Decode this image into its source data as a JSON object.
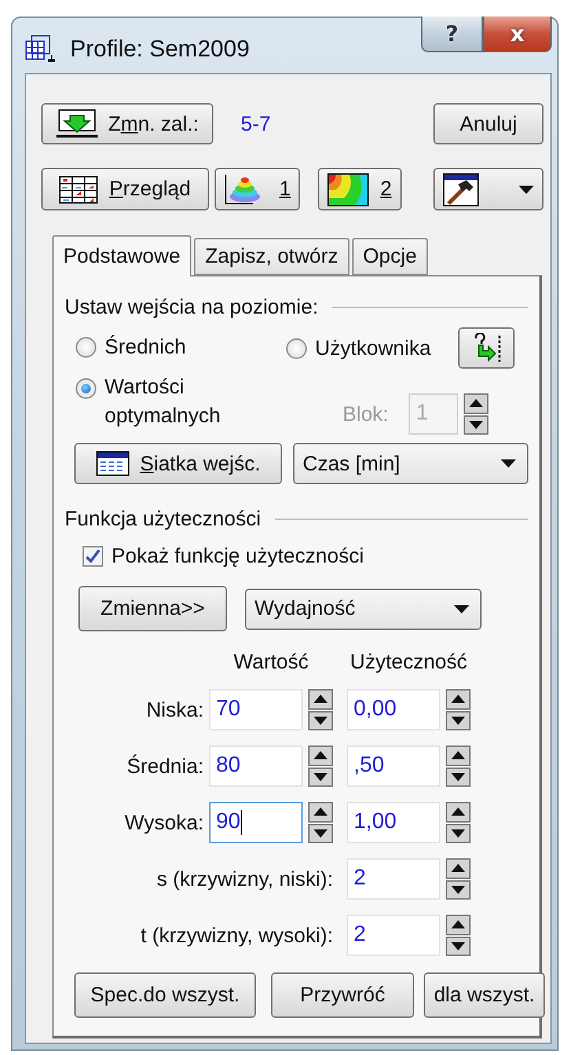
{
  "window": {
    "title": "Profile: Sem2009",
    "help": "?",
    "close": "x"
  },
  "toolbar": {
    "change": {
      "pre": "Z",
      "key": "m",
      "post": "n. zal.:"
    },
    "range": "5-7",
    "cancel": "Anuluj",
    "overview": {
      "key": "P",
      "post": "rzegląd"
    },
    "views": [
      {
        "kind": "layers",
        "key": "1"
      },
      {
        "kind": "contour",
        "key": "2"
      }
    ]
  },
  "tabs": [
    {
      "label": "Podstawowe",
      "selected": true
    },
    {
      "label": "Zapisz, otwórz",
      "selected": false
    },
    {
      "label": "Opcje",
      "selected": false
    }
  ],
  "inputs": {
    "title": "Ustaw wejścia na poziomie:",
    "radios": [
      {
        "label": "Średnich",
        "selected": false
      },
      {
        "label": "Użytkownika",
        "selected": false
      },
      {
        "label": "Wartości optymalnych",
        "selected": true
      }
    ],
    "block": {
      "label": "Blok:",
      "value": "1",
      "disabled": true
    },
    "grid_button": {
      "key": "S",
      "post": "iatka wejśc."
    },
    "unit": "Czas [min]"
  },
  "utility": {
    "title": "Funkcja użyteczności",
    "show": {
      "label": "Pokaż funkcję użyteczności",
      "checked": true
    },
    "variable_button": "Zmienna>>",
    "variable": "Wydajność",
    "columns": [
      "Wartość",
      "Użyteczność"
    ],
    "levels": [
      {
        "label": "Niska:",
        "value": "70",
        "utility": "0,00",
        "focused": false
      },
      {
        "label": "Średnia:",
        "value": "80",
        "utility": ",50",
        "focused": false
      },
      {
        "label": "Wysoka:",
        "value": "90",
        "utility": "1,00",
        "focused": true
      }
    ],
    "curvature": [
      {
        "label": "s (krzywizny, niski):",
        "value": "2"
      },
      {
        "label": "t (krzywizny, wysoki):",
        "value": "2"
      }
    ]
  },
  "buttons": [
    "Spec.do wszyst.",
    "Przywróć",
    "dla wszyst."
  ]
}
